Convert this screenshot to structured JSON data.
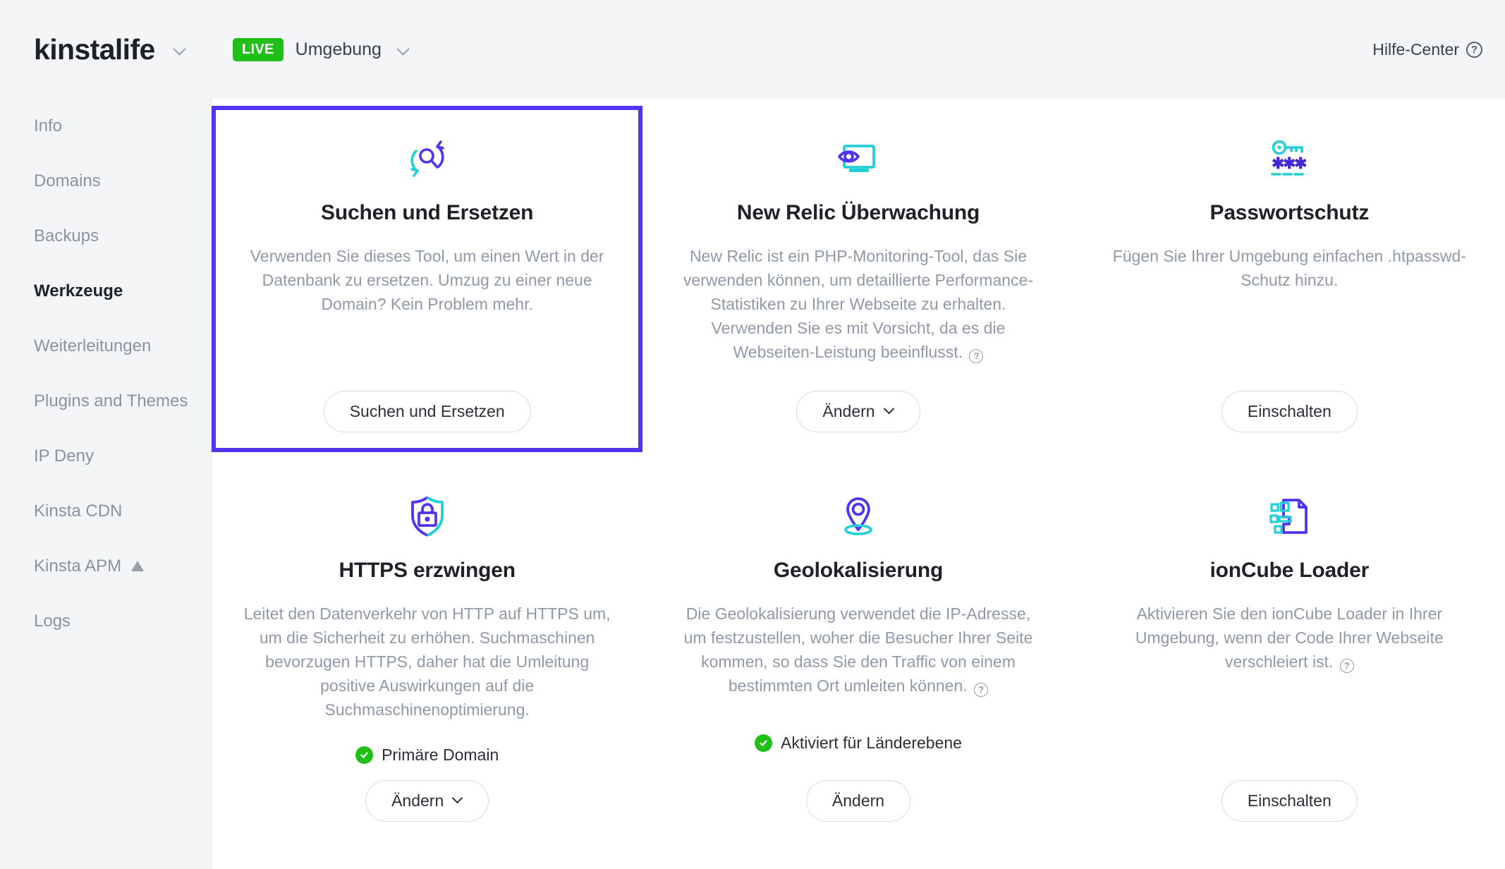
{
  "header": {
    "brand": "kinstalife",
    "brand_caret_icon": "chevron-down-icon",
    "env_badge": "LIVE",
    "env_label": "Umgebung",
    "env_caret_icon": "chevron-down-icon",
    "help_label": "Hilfe-Center",
    "help_icon": "question-circle-icon"
  },
  "sidebar": {
    "items": [
      {
        "label": "Info",
        "active": false
      },
      {
        "label": "Domains",
        "active": false
      },
      {
        "label": "Backups",
        "active": false
      },
      {
        "label": "Werkzeuge",
        "active": true
      },
      {
        "label": "Weiterleitungen",
        "active": false
      },
      {
        "label": "Plugins and Themes",
        "active": false
      },
      {
        "label": "IP Deny",
        "active": false
      },
      {
        "label": "Kinsta CDN",
        "active": false
      },
      {
        "label": "Kinsta APM",
        "active": false,
        "badge_icon": "triangle-badge-icon"
      },
      {
        "label": "Logs",
        "active": false
      }
    ]
  },
  "colors": {
    "accent_purple": "#5333ed",
    "accent_teal": "#22cfd6",
    "status_green": "#21c018",
    "text_dark": "#1e2127",
    "text_muted": "#9099a8"
  },
  "cards": [
    {
      "id": "search-and-replace",
      "icon": "search-replace-icon",
      "title": "Suchen und Ersetzen",
      "description": "Verwenden Sie dieses Tool, um einen Wert in der Datenbank zu ersetzen. Umzug zu einer neue Domain? Kein Problem mehr.",
      "has_help_icon": false,
      "selected": true,
      "status": null,
      "button": {
        "label": "Suchen und Ersetzen",
        "has_caret": false
      }
    },
    {
      "id": "new-relic-monitoring",
      "icon": "monitor-eye-icon",
      "title": "New Relic Überwachung",
      "description": "New Relic ist ein PHP-Monitoring-Tool, das Sie verwenden können, um detaillierte Performance-Statistiken zu Ihrer Webseite zu erhalten. Verwenden Sie es mit Vorsicht, da es die Webseiten-Leistung beeinflusst.",
      "has_help_icon": true,
      "selected": false,
      "status": null,
      "button": {
        "label": "Ändern",
        "has_caret": true
      }
    },
    {
      "id": "password-protection",
      "icon": "key-asterisks-icon",
      "title": "Passwortschutz",
      "description": "Fügen Sie Ihrer Umgebung einfachen .htpasswd-Schutz hinzu.",
      "has_help_icon": false,
      "selected": false,
      "status": null,
      "button": {
        "label": "Einschalten",
        "has_caret": false
      }
    },
    {
      "id": "force-https",
      "icon": "shield-lock-icon",
      "title": "HTTPS erzwingen",
      "description": "Leitet den Datenverkehr von HTTP auf HTTPS um, um die Sicherheit zu erhöhen. Suchmaschinen bevorzugen HTTPS, daher hat die Umleitung positive Auswirkungen auf die Suchmaschinenoptimierung.",
      "has_help_icon": false,
      "selected": false,
      "status": {
        "icon": "check-circle-icon",
        "label": "Primäre Domain"
      },
      "button": {
        "label": "Ändern",
        "has_caret": true
      }
    },
    {
      "id": "geolocation",
      "icon": "map-pin-icon",
      "title": "Geolokalisierung",
      "description": "Die Geolokalisierung verwendet die IP-Adresse, um festzustellen, woher die Besucher Ihrer Seite kommen, so dass Sie den Traffic von einem bestimmten Ort umleiten können.",
      "has_help_icon": true,
      "selected": false,
      "status": {
        "icon": "check-circle-icon",
        "label": "Aktiviert für Länderebene"
      },
      "button": {
        "label": "Ändern",
        "has_caret": false
      }
    },
    {
      "id": "ioncube-loader",
      "icon": "document-blocks-icon",
      "title": "ionCube Loader",
      "description": "Aktivieren Sie den ionCube Loader in Ihrer Umgebung, wenn der Code Ihrer Webseite verschleiert ist.",
      "has_help_icon": true,
      "selected": false,
      "status": null,
      "button": {
        "label": "Einschalten",
        "has_caret": false
      }
    }
  ]
}
